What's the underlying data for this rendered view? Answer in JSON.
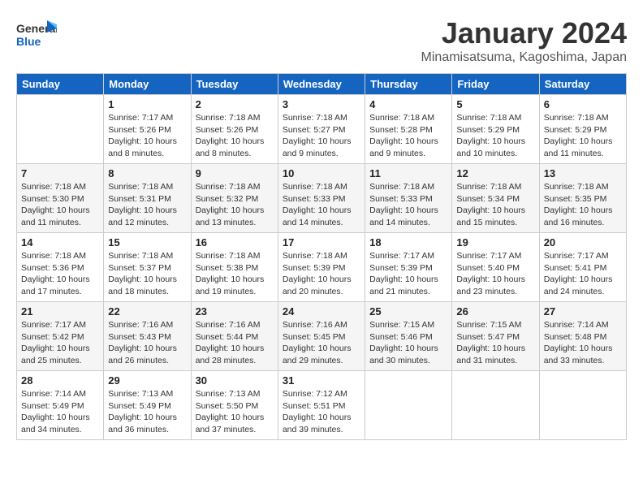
{
  "header": {
    "logo_general": "General",
    "logo_blue": "Blue",
    "month": "January 2024",
    "location": "Minamisatsuma, Kagoshima, Japan"
  },
  "weekdays": [
    "Sunday",
    "Monday",
    "Tuesday",
    "Wednesday",
    "Thursday",
    "Friday",
    "Saturday"
  ],
  "weeks": [
    [
      {
        "day": "",
        "info": ""
      },
      {
        "day": "1",
        "info": "Sunrise: 7:17 AM\nSunset: 5:26 PM\nDaylight: 10 hours\nand 8 minutes."
      },
      {
        "day": "2",
        "info": "Sunrise: 7:18 AM\nSunset: 5:26 PM\nDaylight: 10 hours\nand 8 minutes."
      },
      {
        "day": "3",
        "info": "Sunrise: 7:18 AM\nSunset: 5:27 PM\nDaylight: 10 hours\nand 9 minutes."
      },
      {
        "day": "4",
        "info": "Sunrise: 7:18 AM\nSunset: 5:28 PM\nDaylight: 10 hours\nand 9 minutes."
      },
      {
        "day": "5",
        "info": "Sunrise: 7:18 AM\nSunset: 5:29 PM\nDaylight: 10 hours\nand 10 minutes."
      },
      {
        "day": "6",
        "info": "Sunrise: 7:18 AM\nSunset: 5:29 PM\nDaylight: 10 hours\nand 11 minutes."
      }
    ],
    [
      {
        "day": "7",
        "info": "Sunrise: 7:18 AM\nSunset: 5:30 PM\nDaylight: 10 hours\nand 11 minutes."
      },
      {
        "day": "8",
        "info": "Sunrise: 7:18 AM\nSunset: 5:31 PM\nDaylight: 10 hours\nand 12 minutes."
      },
      {
        "day": "9",
        "info": "Sunrise: 7:18 AM\nSunset: 5:32 PM\nDaylight: 10 hours\nand 13 minutes."
      },
      {
        "day": "10",
        "info": "Sunrise: 7:18 AM\nSunset: 5:33 PM\nDaylight: 10 hours\nand 14 minutes."
      },
      {
        "day": "11",
        "info": "Sunrise: 7:18 AM\nSunset: 5:33 PM\nDaylight: 10 hours\nand 14 minutes."
      },
      {
        "day": "12",
        "info": "Sunrise: 7:18 AM\nSunset: 5:34 PM\nDaylight: 10 hours\nand 15 minutes."
      },
      {
        "day": "13",
        "info": "Sunrise: 7:18 AM\nSunset: 5:35 PM\nDaylight: 10 hours\nand 16 minutes."
      }
    ],
    [
      {
        "day": "14",
        "info": "Sunrise: 7:18 AM\nSunset: 5:36 PM\nDaylight: 10 hours\nand 17 minutes."
      },
      {
        "day": "15",
        "info": "Sunrise: 7:18 AM\nSunset: 5:37 PM\nDaylight: 10 hours\nand 18 minutes."
      },
      {
        "day": "16",
        "info": "Sunrise: 7:18 AM\nSunset: 5:38 PM\nDaylight: 10 hours\nand 19 minutes."
      },
      {
        "day": "17",
        "info": "Sunrise: 7:18 AM\nSunset: 5:39 PM\nDaylight: 10 hours\nand 20 minutes."
      },
      {
        "day": "18",
        "info": "Sunrise: 7:17 AM\nSunset: 5:39 PM\nDaylight: 10 hours\nand 21 minutes."
      },
      {
        "day": "19",
        "info": "Sunrise: 7:17 AM\nSunset: 5:40 PM\nDaylight: 10 hours\nand 23 minutes."
      },
      {
        "day": "20",
        "info": "Sunrise: 7:17 AM\nSunset: 5:41 PM\nDaylight: 10 hours\nand 24 minutes."
      }
    ],
    [
      {
        "day": "21",
        "info": "Sunrise: 7:17 AM\nSunset: 5:42 PM\nDaylight: 10 hours\nand 25 minutes."
      },
      {
        "day": "22",
        "info": "Sunrise: 7:16 AM\nSunset: 5:43 PM\nDaylight: 10 hours\nand 26 minutes."
      },
      {
        "day": "23",
        "info": "Sunrise: 7:16 AM\nSunset: 5:44 PM\nDaylight: 10 hours\nand 28 minutes."
      },
      {
        "day": "24",
        "info": "Sunrise: 7:16 AM\nSunset: 5:45 PM\nDaylight: 10 hours\nand 29 minutes."
      },
      {
        "day": "25",
        "info": "Sunrise: 7:15 AM\nSunset: 5:46 PM\nDaylight: 10 hours\nand 30 minutes."
      },
      {
        "day": "26",
        "info": "Sunrise: 7:15 AM\nSunset: 5:47 PM\nDaylight: 10 hours\nand 31 minutes."
      },
      {
        "day": "27",
        "info": "Sunrise: 7:14 AM\nSunset: 5:48 PM\nDaylight: 10 hours\nand 33 minutes."
      }
    ],
    [
      {
        "day": "28",
        "info": "Sunrise: 7:14 AM\nSunset: 5:49 PM\nDaylight: 10 hours\nand 34 minutes."
      },
      {
        "day": "29",
        "info": "Sunrise: 7:13 AM\nSunset: 5:49 PM\nDaylight: 10 hours\nand 36 minutes."
      },
      {
        "day": "30",
        "info": "Sunrise: 7:13 AM\nSunset: 5:50 PM\nDaylight: 10 hours\nand 37 minutes."
      },
      {
        "day": "31",
        "info": "Sunrise: 7:12 AM\nSunset: 5:51 PM\nDaylight: 10 hours\nand 39 minutes."
      },
      {
        "day": "",
        "info": ""
      },
      {
        "day": "",
        "info": ""
      },
      {
        "day": "",
        "info": ""
      }
    ]
  ]
}
